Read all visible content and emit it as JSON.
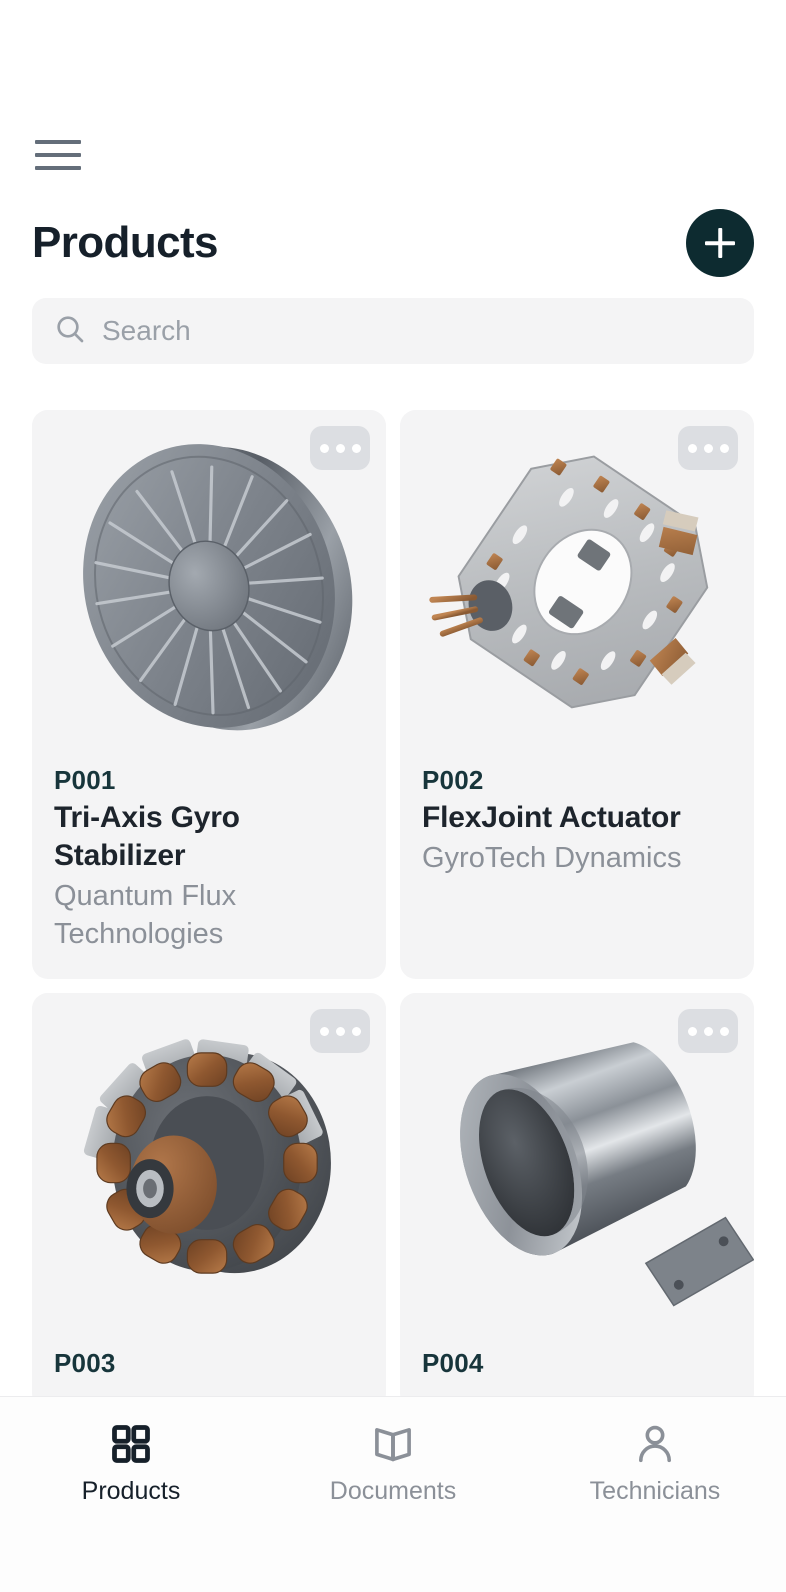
{
  "header": {
    "menu_icon": "hamburger-menu-icon",
    "title": "Products",
    "add_label": "+",
    "add_icon": "plus-icon"
  },
  "search": {
    "placeholder": "Search",
    "value": "",
    "icon": "search-icon"
  },
  "card_actions": {
    "more_icon": "more-horizontal-icon"
  },
  "products": [
    {
      "sku": "P001",
      "name": "Tri-Axis Gyro Stabilizer",
      "vendor": "Quantum Flux Technologies",
      "image": "gyro-disc-flywheel"
    },
    {
      "sku": "P002",
      "name": "FlexJoint Actuator",
      "vendor": "GyroTech Dynamics",
      "image": "octagonal-coupling-plate"
    },
    {
      "sku": "P003",
      "name": "",
      "vendor": "",
      "image": "copper-wound-stator"
    },
    {
      "sku": "P004",
      "name": "",
      "vendor": "",
      "image": "chrome-cylinder-housing"
    }
  ],
  "bottom_nav": {
    "items": [
      {
        "label": "Products",
        "icon": "grid-icon",
        "active": true
      },
      {
        "label": "Documents",
        "icon": "book-icon",
        "active": false
      },
      {
        "label": "Technicians",
        "icon": "person-icon",
        "active": false
      }
    ]
  },
  "colors": {
    "accent": "#0d2b30",
    "card_bg": "#f4f4f5",
    "page_bg": "#ffffff",
    "sku_text": "#17353b",
    "title_text": "#1d242c",
    "muted_text": "#8b9098"
  }
}
